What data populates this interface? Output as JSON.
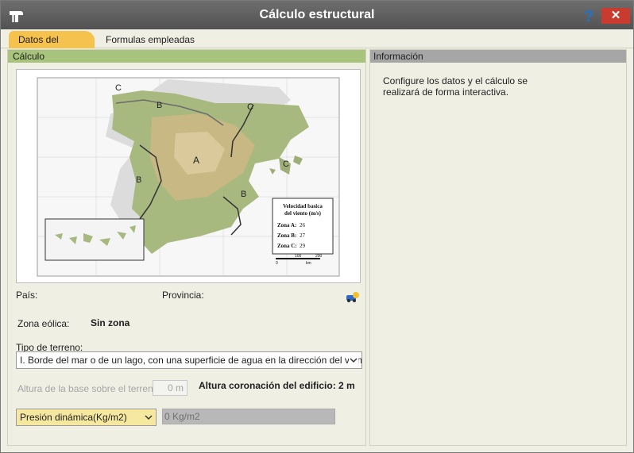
{
  "window": {
    "title": "Cálculo estructural"
  },
  "tabs": [
    {
      "label": "Datos del cálculo",
      "active": true
    },
    {
      "label": "Formulas empleadas",
      "active": false
    }
  ],
  "left_panel": {
    "header": "Cálculo",
    "map": {
      "zones": [
        "A",
        "B",
        "B",
        "B",
        "C",
        "C",
        "C",
        "C",
        "C"
      ],
      "legend_title_1": "Velocidad basica",
      "legend_title_2": "del viento (m/s)",
      "legend_entries": [
        {
          "label": "Zona A:",
          "value": "26"
        },
        {
          "label": "Zona B:",
          "value": "27"
        },
        {
          "label": "Zona C:",
          "value": "29"
        }
      ],
      "scale_label": "km",
      "scale_ticks": [
        "0",
        "100",
        "200"
      ]
    },
    "pais_label": "País:",
    "provincia_label": "Provincia:",
    "zona_label": "Zona eólica:",
    "zona_value": "Sin zona",
    "terreno_label": "Tipo de terreno:",
    "terreno_value": "I. Borde del mar o de un lago, con una superficie de agua en la dirección del viento de",
    "altura_label": "Altura de la base sobre el terreno:",
    "altura_value": "0 m",
    "coronacion_label": "Altura coronación del edificio: 2 m",
    "presion_select": "Presión dinámica(Kg/m2)",
    "presion_value": "0 Kg/m2"
  },
  "right_panel": {
    "header": "Información",
    "text": "Configure los datos y el cálculo se realizará de forma interactiva."
  },
  "colors": {
    "title_bar": "#5f5f5f",
    "active_tab": "#f5c24d",
    "left_header": "#a8c47c",
    "right_header": "#a6a6a6",
    "close_button": "#c93b2e",
    "help_icon": "#1f73c9",
    "presion_select_bg": "#f7e8a0"
  }
}
